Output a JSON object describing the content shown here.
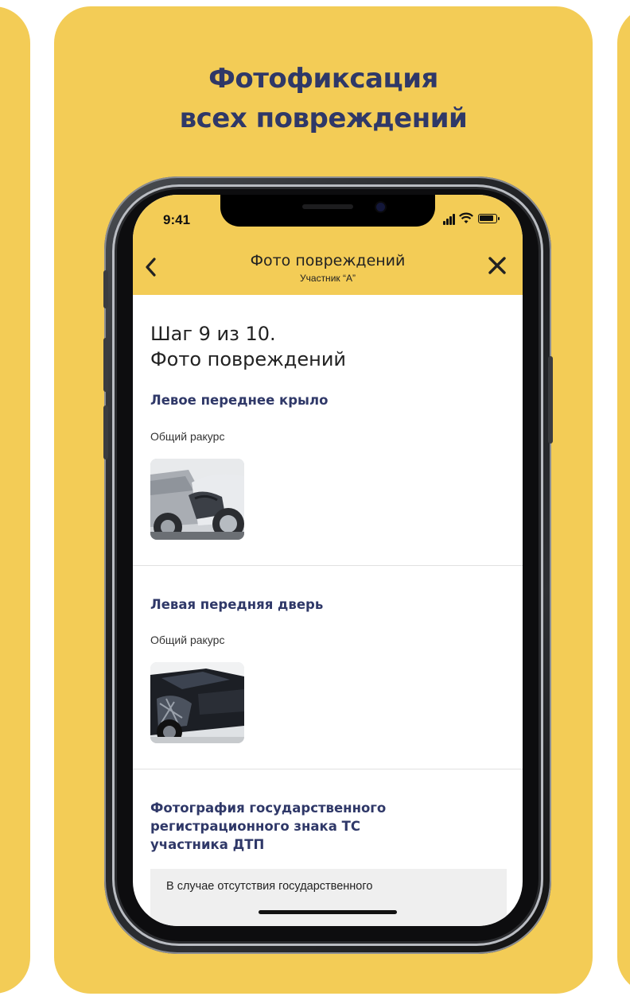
{
  "promo": {
    "title_line1": "Фотофиксация",
    "title_line2": "всех повреждений",
    "background_color": "#F3CC56",
    "title_color": "#2F3868"
  },
  "status_bar": {
    "time": "9:41",
    "icons": [
      "signal-icon",
      "wifi-icon",
      "battery-icon"
    ]
  },
  "nav": {
    "title": "Фото повреждений",
    "subtitle": "Участник “А”",
    "back_icon": "chevron-left-icon",
    "close_icon": "close-icon"
  },
  "step": {
    "line1": "Шаг 9 из 10.",
    "line2": "Фото повреждений"
  },
  "sections": [
    {
      "heading": "Левое переднее крыло",
      "view_label": "Общий ракурс",
      "photo": "damaged-front-fender-photo"
    },
    {
      "heading": "Левая передняя дверь",
      "view_label": "Общий ракурс",
      "photo": "damaged-front-door-photo"
    }
  ],
  "plate_section": {
    "heading_line1": "Фотография государственного",
    "heading_line2": "регистрационного знака ТС",
    "heading_line3": "участника ДТП",
    "info_text": "В случае отсутствия государственного"
  }
}
